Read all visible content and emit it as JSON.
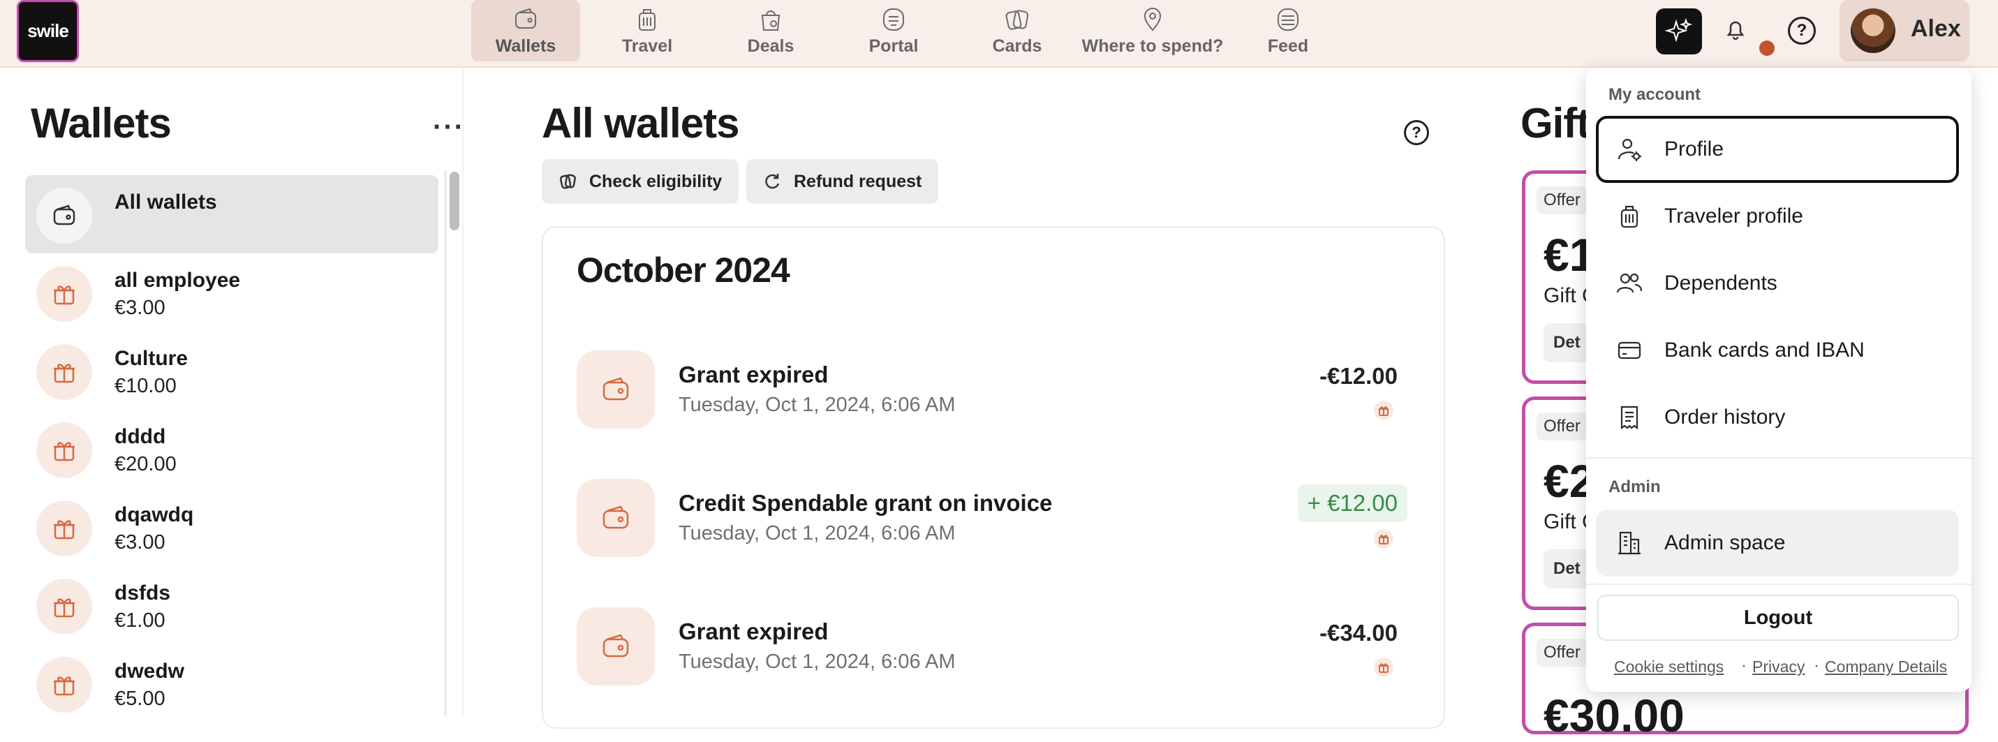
{
  "brand": {
    "logo_text": "swile"
  },
  "nav": {
    "items": [
      {
        "label": "Wallets",
        "icon": "wallet-icon",
        "active": true
      },
      {
        "label": "Travel",
        "icon": "luggage-icon"
      },
      {
        "label": "Deals",
        "icon": "shopping-bag-icon"
      },
      {
        "label": "Portal",
        "icon": "portal-icon"
      },
      {
        "label": "Cards",
        "icon": "cards-icon"
      },
      {
        "label": "Where to spend?",
        "icon": "map-pin-icon"
      },
      {
        "label": "Feed",
        "icon": "feed-icon"
      }
    ]
  },
  "account": {
    "name": "Alex"
  },
  "sidebar": {
    "title": "Wallets",
    "more_label": "···",
    "items": [
      {
        "name": "All wallets",
        "amount": ""
      },
      {
        "name": "all employee",
        "amount": "€3.00"
      },
      {
        "name": "Culture",
        "amount": "€10.00"
      },
      {
        "name": "dddd",
        "amount": "€20.00"
      },
      {
        "name": "dqawdq",
        "amount": "€3.00"
      },
      {
        "name": "dsfds",
        "amount": "€1.00"
      },
      {
        "name": "dwedw",
        "amount": "€5.00"
      }
    ]
  },
  "main": {
    "title": "All wallets",
    "help": "?",
    "actions": [
      {
        "label": "Check eligibility"
      },
      {
        "label": "Refund request"
      }
    ],
    "month": "October 2024",
    "transactions": [
      {
        "title": "Grant expired",
        "date": "Tuesday, Oct 1, 2024, 6:06 AM",
        "amount": "-€12.00",
        "positive": false
      },
      {
        "title": "Credit Spendable grant on invoice",
        "date": "Tuesday, Oct 1, 2024, 6:06 AM",
        "amount": "+ €12.00",
        "positive": true
      },
      {
        "title": "Grant expired",
        "date": "Tuesday, Oct 1, 2024, 6:06 AM",
        "amount": "-€34.00",
        "positive": false
      }
    ]
  },
  "gift": {
    "title": "Gift",
    "cards": [
      {
        "offer": "Offer",
        "amount": "€1",
        "sub": "Gift C",
        "details": "Det"
      },
      {
        "offer": "Offer",
        "amount": "€2",
        "sub": "Gift C",
        "details": "Det"
      },
      {
        "offer": "Offer",
        "amount": "€30.00"
      }
    ]
  },
  "dropdown": {
    "section_account": "My account",
    "items": [
      {
        "label": "Profile",
        "icon": "user-settings-icon"
      },
      {
        "label": "Traveler profile",
        "icon": "luggage-icon"
      },
      {
        "label": "Dependents",
        "icon": "users-icon"
      },
      {
        "label": "Bank cards and IBAN",
        "icon": "credit-card-icon"
      },
      {
        "label": "Order history",
        "icon": "receipt-icon"
      }
    ],
    "section_admin": "Admin",
    "admin_item": {
      "label": "Admin space",
      "icon": "building-icon"
    },
    "logout": "Logout",
    "footer": {
      "cookie": "Cookie settings",
      "privacy": "Privacy",
      "company": "Company Details",
      "sep": "·"
    }
  },
  "colors": {
    "accent": "#d8693f",
    "gift_border": "#c24ea8",
    "positive": "#3a8a4a",
    "nav_bg": "#f8eeea"
  }
}
